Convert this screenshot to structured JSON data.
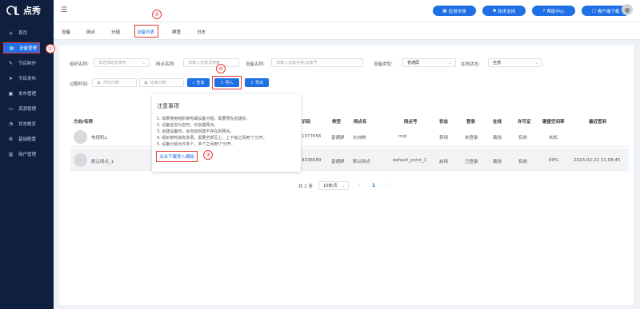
{
  "app": {
    "name": "点秀"
  },
  "top_buttons": [
    "应用市场",
    "技术支持",
    "帮助中心",
    "客户端下载"
  ],
  "sidebar": {
    "items": [
      {
        "label": "首页",
        "icon": "home-icon",
        "glyph": "⌂"
      },
      {
        "label": "设备管理",
        "icon": "device-icon",
        "glyph": "▤"
      },
      {
        "label": "节目制作",
        "icon": "edit-icon",
        "glyph": "✎"
      },
      {
        "label": "节目发布",
        "icon": "send-icon",
        "glyph": "➤"
      },
      {
        "label": "发布管理",
        "icon": "publish-icon",
        "glyph": "▣"
      },
      {
        "label": "资源管理",
        "icon": "folder-icon",
        "glyph": "▭"
      },
      {
        "label": "状态概览",
        "icon": "chart-icon",
        "glyph": "◔"
      },
      {
        "label": "基础配置",
        "icon": "gear-icon",
        "glyph": "⚙"
      },
      {
        "label": "商户管理",
        "icon": "shop-icon",
        "glyph": "▥"
      }
    ]
  },
  "tabs": [
    "设备",
    "网点",
    "分组",
    "设备列表",
    "屏管",
    "日志"
  ],
  "annotations": {
    "n1": "①",
    "n2": "②",
    "n3": "③",
    "n4": "④"
  },
  "filters": {
    "org_label": "组织名称:",
    "org_ph": "请选择组织架构",
    "site_label": "网点名称:",
    "site_ph": "请输入关键词搜索",
    "device_label": "设备名称:",
    "device_ph": "请输入设备名称/设备号",
    "type_label": "设备类型:",
    "type_val": "普通屏",
    "online_label": "在线状态:",
    "online_val": "全部",
    "expiry_label": "过期时间:",
    "start_ph": "开始日期",
    "end_ph": "结束日期"
  },
  "actions": {
    "search": "查询",
    "import": "导入",
    "export": "导出"
  },
  "table": {
    "headers": [
      "方向/名称",
      "识码",
      "类型",
      "网点名",
      "网点号",
      "状态",
      "登录",
      "在线",
      "许可证",
      "硬盘空间率",
      "最近签到"
    ],
    "rows": [
      {
        "name": "电视机1",
        "code": "1077656",
        "type": "普通屏",
        "site": "水洲林",
        "site_no": "mqi",
        "status": "禁用",
        "login": "未登录",
        "online": "离线",
        "license": "有效",
        "disk": "未知",
        "last": ""
      },
      {
        "name": "默认网点_1",
        "code": "4336589",
        "type": "普通屏",
        "site": "默认网点",
        "site_no": "default_point_1",
        "status": "启用",
        "login": "已登录",
        "online": "离线",
        "license": "有效",
        "disk": "99%",
        "last": "2023-02-22 11:08:45"
      }
    ]
  },
  "popover": {
    "title": "注意事项",
    "lines": [
      "1. 如果使用组织架构或设备分组，需要预先创建好。",
      "2. 设备信息为空时，仅创建网点。",
      "3. 创建设备时，会自动创建不存在的网点。",
      "4. 组织架构如有多层，需要全部写上，上下级之间用\"/\"分开。",
      "5. 设备分组允许多个，多个之间用\"/\"分开。"
    ],
    "link": "点击下载导入模板"
  },
  "pagination": {
    "total": "共 2 条",
    "size": "10条/页",
    "page": "1",
    "prev": "‹",
    "next": "›"
  }
}
